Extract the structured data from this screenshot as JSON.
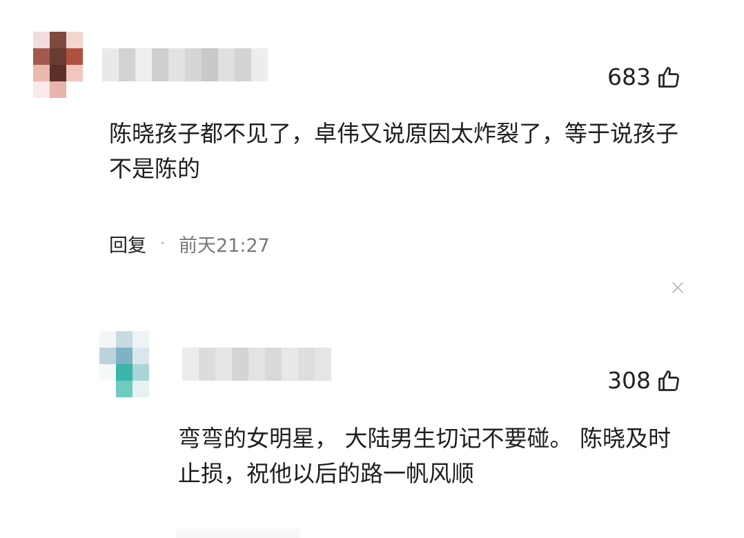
{
  "comments": [
    {
      "like_count": "683",
      "text": "陈晓孩子都不见了，卓伟又说原因太炸裂了，等于说孩子不是陈的",
      "reply_label": "回复",
      "meta_separator": "·",
      "timestamp": "前天21:27",
      "avatar_colors": [
        "#f1dddd",
        "#7d4a3f",
        "#f4d6d1",
        "#a35a4c",
        "#6a3b33",
        "#b1503f",
        "#eab8ad",
        "#5a3028",
        "#f0c6bd",
        "#fbeaea",
        "#e7b3ad",
        "#ffffff"
      ],
      "username_colors": [
        "#e9e9e9",
        "#d2d2d2",
        "#eeeeee",
        "#cfcfcf",
        "#e2e2e2",
        "#d6d6d6",
        "#c9c9c9",
        "#e0e0e0",
        "#d3d3d3",
        "#ededed"
      ]
    },
    {
      "like_count": "308",
      "text": "弯弯的女明星， 大陆男生切记不要碰。 陈晓及时止损，祝他以后的路一帆风顺",
      "avatar_colors": [
        "#f3f6f7",
        "#c7dbe3",
        "#eef4f6",
        "#bcd3dc",
        "#7fb3c4",
        "#d9e7ec",
        "#f5f8f9",
        "#3ab5a9",
        "#a9d5d8",
        "#ffffff",
        "#6fcabf",
        "#e6f2f2"
      ],
      "username_colors": [
        "#ececec",
        "#dcdcdc",
        "#e6e6e6",
        "#d4d4d4",
        "#e3e3e3",
        "#d9d9d9",
        "#e8e8e8",
        "#dedede",
        "#e5e5e5"
      ]
    }
  ],
  "icons": {
    "like": "thumbs-up-icon",
    "close": "close-icon"
  }
}
